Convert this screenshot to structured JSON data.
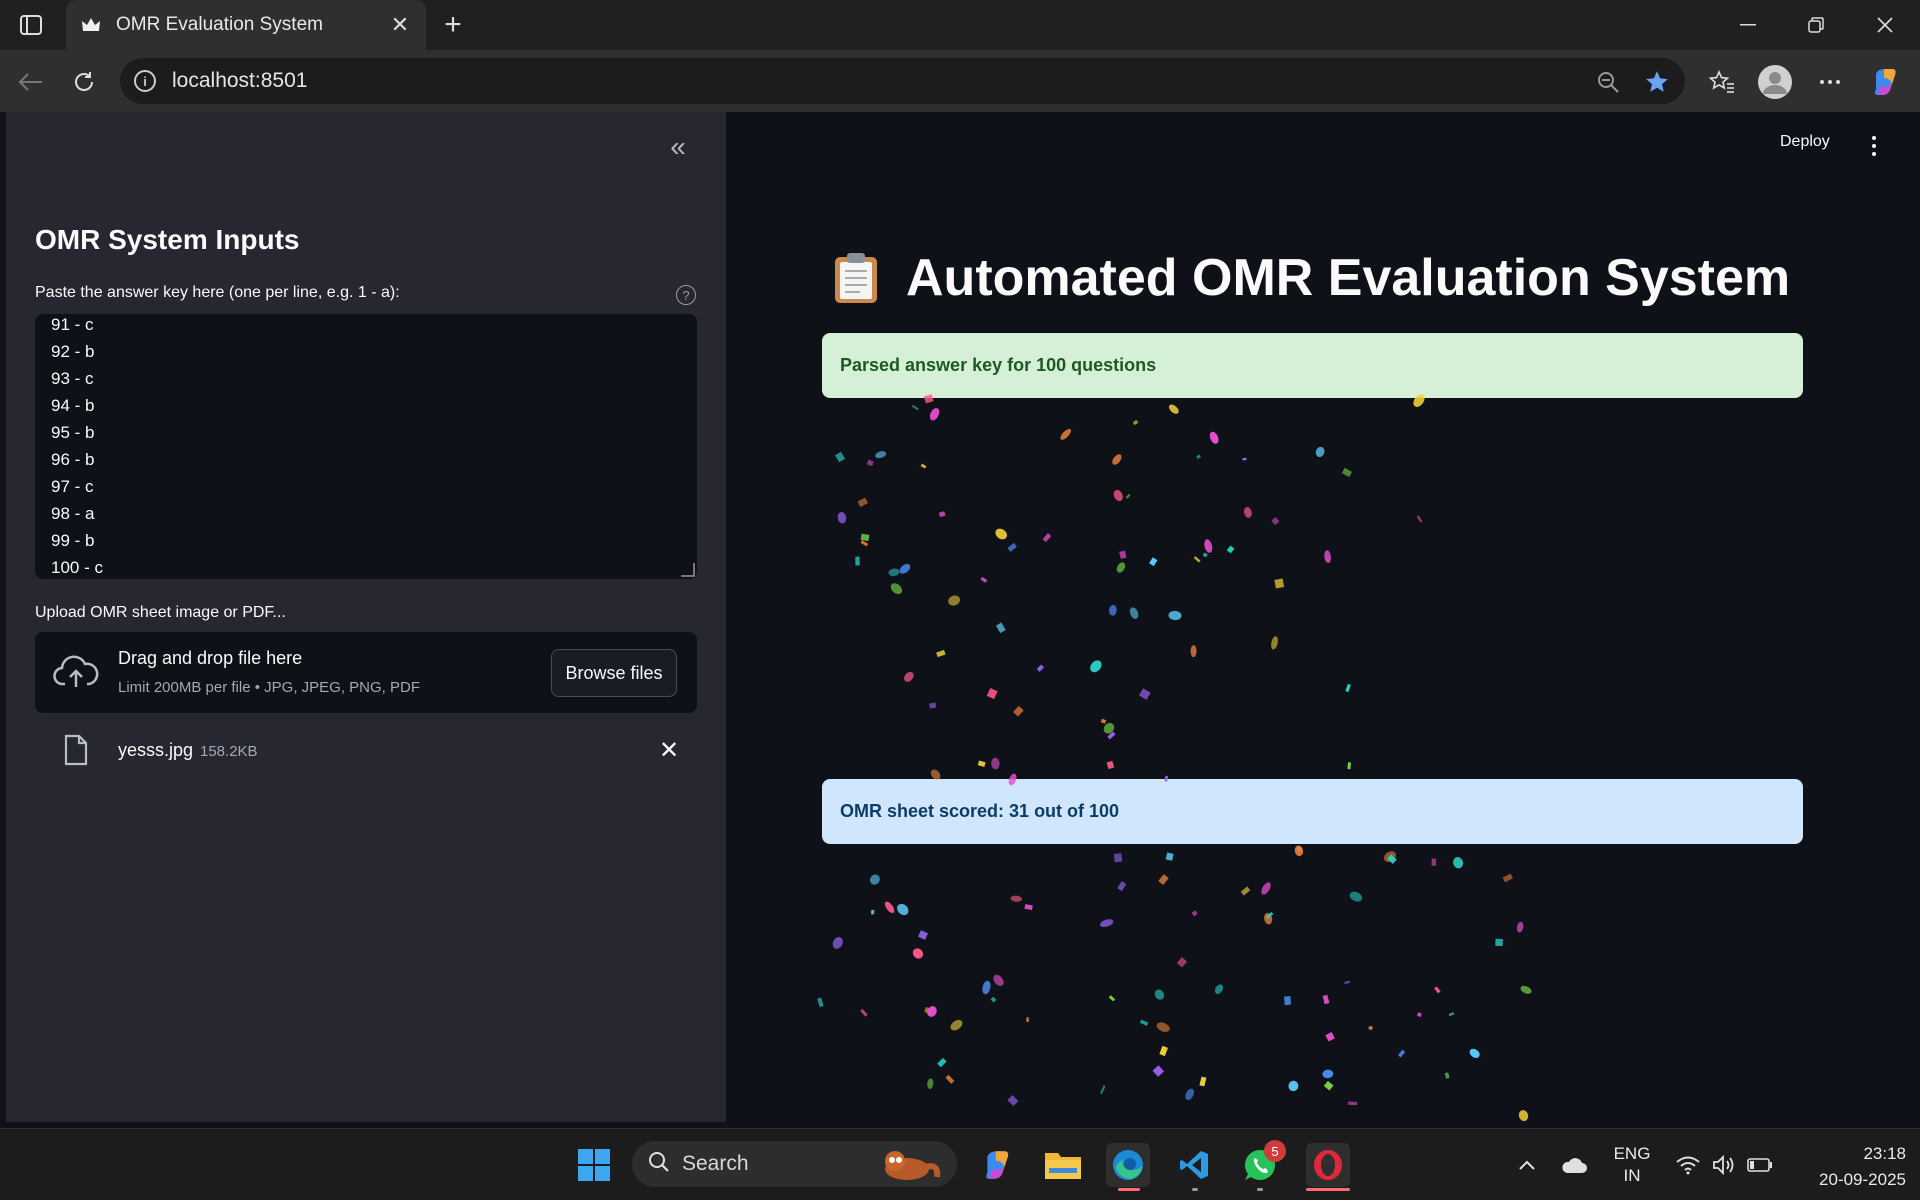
{
  "browser": {
    "tab_title": "OMR Evaluation System",
    "url": "localhost:8501"
  },
  "sidebar": {
    "title": "OMR System Inputs",
    "answer_key_label": "Paste the answer key here (one per line, e.g. 1 - a):",
    "answer_key_lines": [
      "91 - c",
      "92 - b",
      "93 - c",
      "94 - b",
      "95 - b",
      "96 - b",
      "97 - c",
      "98 - a",
      "99 - b",
      "100 - c"
    ],
    "upload_label": "Upload OMR sheet image or PDF...",
    "dropzone_title": "Drag and drop file here",
    "dropzone_limit": "Limit 200MB per file • JPG, JPEG, PNG, PDF",
    "browse_label": "Browse files",
    "file_name": "yesss.jpg",
    "file_size": "158.2KB"
  },
  "main": {
    "deploy_label": "Deploy",
    "title": "Automated OMR Evaluation System",
    "success_message": "Parsed answer key for 100 questions",
    "info_message": "OMR sheet scored: 31 out of 100"
  },
  "taskbar": {
    "search_label": "Search",
    "lang_line1": "ENG",
    "lang_line2": "IN",
    "time": "23:18",
    "date": "20-09-2025",
    "whatsapp_badge": "5"
  },
  "colors": {
    "sidebar_bg": "#262730",
    "main_bg": "#0e1117",
    "success_bg": "#d6f0d7",
    "info_bg": "#cfe6fd"
  }
}
